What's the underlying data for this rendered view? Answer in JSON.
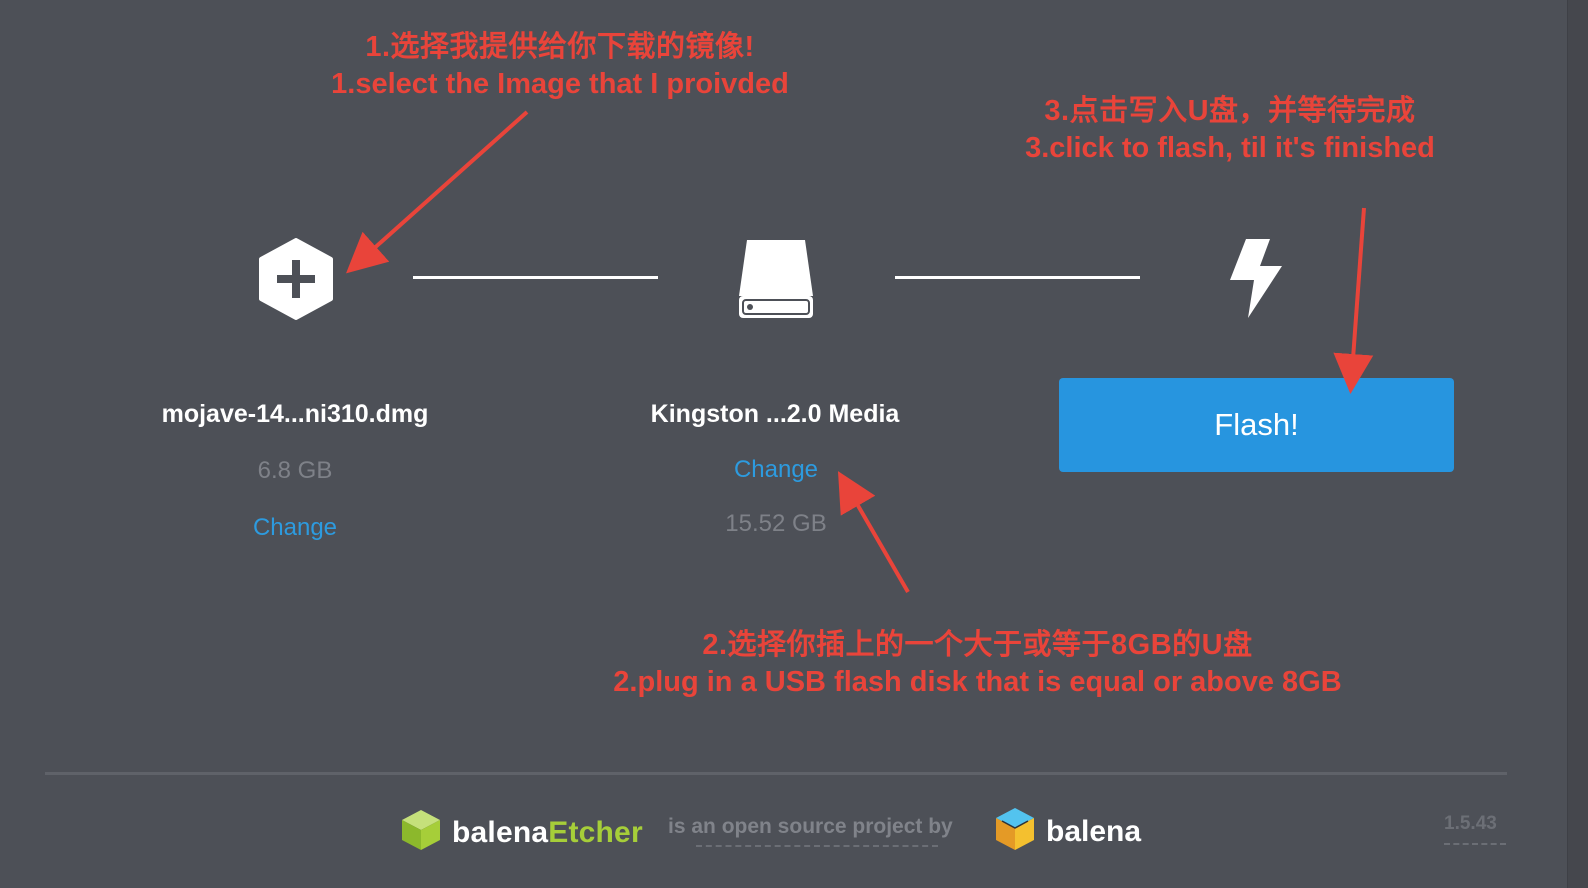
{
  "annotations": {
    "step1": {
      "zh": "1.选择我提供给你下载的镜像!",
      "en": "1.select the Image that I proivded"
    },
    "step2": {
      "zh": "2.选择你插上的一个大于或等于8GB的U盘",
      "en": "2.plug in a USB flash disk that is equal or above 8GB"
    },
    "step3": {
      "zh": "3.点击写入U盘，并等待完成",
      "en": "3.click to flash, til it's finished"
    },
    "color": "#e9443a"
  },
  "image_step": {
    "icon": "plus-hexagon-icon",
    "filename": "mojave-14...ni310.dmg",
    "size": "6.8 GB",
    "change_label": "Change"
  },
  "drive_step": {
    "icon": "drive-icon",
    "name": "Kingston ...2.0 Media",
    "change_label": "Change",
    "size": "15.52 GB"
  },
  "flash_step": {
    "icon": "lightning-icon",
    "button_label": "Flash!"
  },
  "footer": {
    "brand_prefix": "balena",
    "brand_suffix": "Etcher",
    "tagline": "is an open source project by",
    "company": "balena",
    "version": "1.5.43"
  },
  "colors": {
    "background": "#4d5057",
    "accent": "#2795df",
    "link": "#2d9bdf",
    "etcher_green": "#a6ce39"
  }
}
